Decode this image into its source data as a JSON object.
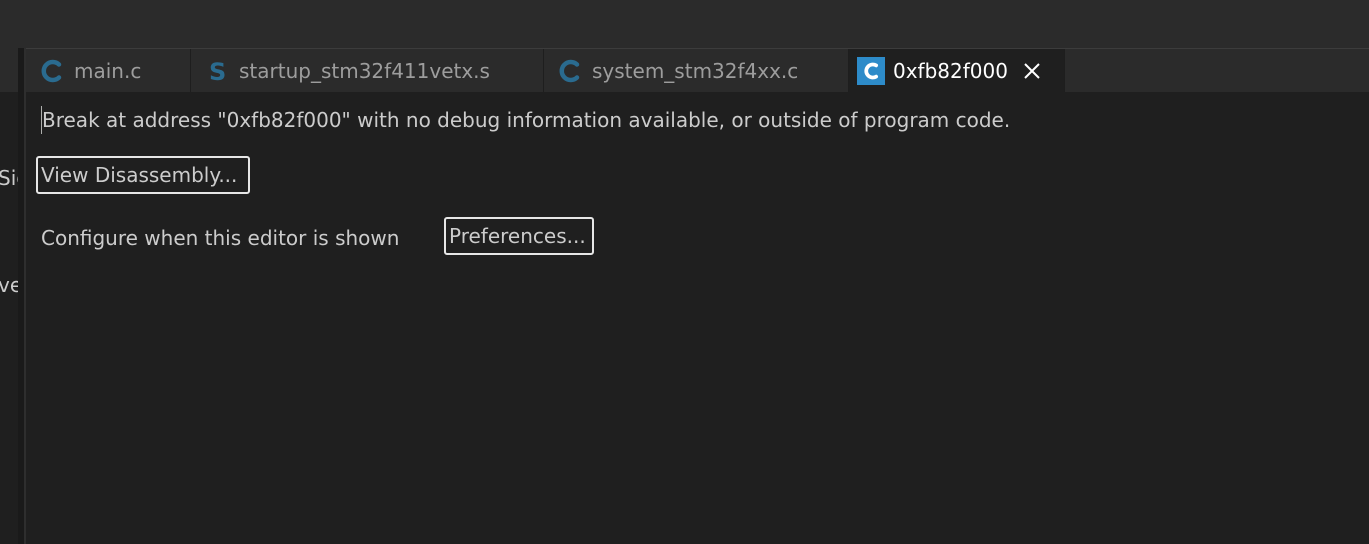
{
  "tabs": [
    {
      "label": "main.c",
      "icon": "c-file-icon",
      "active": false
    },
    {
      "label": "startup_stm32f411vetx.s",
      "icon": "asm-file-icon",
      "active": false
    },
    {
      "label": "system_stm32f4xx.c",
      "icon": "c-file-icon",
      "active": false
    },
    {
      "label": "0xfb82f000",
      "icon": "c-file-icon",
      "active": true
    }
  ],
  "sidebar": {
    "fragment_1": "Sig",
    "fragment_2": "ve"
  },
  "editor": {
    "message": "Break at address \"0xfb82f000\" with no debug information available, or outside of program code.",
    "view_disassembly_label": "View Disassembly...",
    "configure_text": "Configure when this editor is shown",
    "preferences_label": "Preferences..."
  },
  "colors": {
    "background": "#1f1f1f",
    "tabbar": "#2b2b2b",
    "c_icon": "#2a6b8f",
    "active_c_icon_bg": "#2d8bc9",
    "text": "#cccccc",
    "button_border": "#e6e6e6"
  }
}
